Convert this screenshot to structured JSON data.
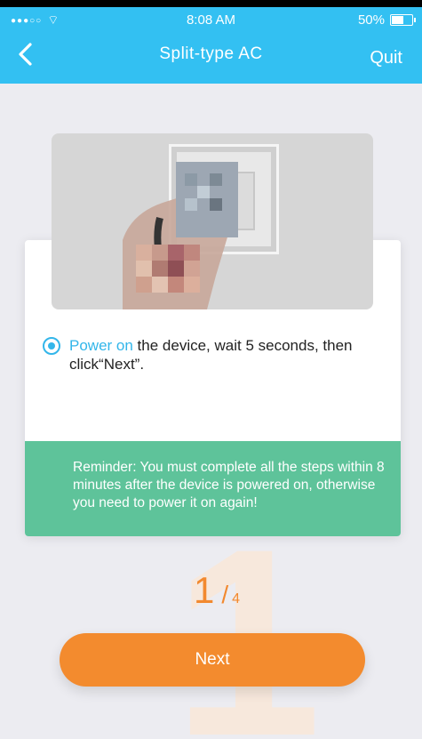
{
  "status_bar": {
    "time": "8:08 AM",
    "battery": "50%"
  },
  "nav": {
    "title": "Split-type AC",
    "quit_label": "Quit"
  },
  "instruction": {
    "highlight": "Power on",
    "text": " the device, wait 5 seconds, then click“Next”."
  },
  "reminder": {
    "text": "Reminder: You must complete all the steps within 8 minutes after the device is powered on, otherwise you need to power it on again!"
  },
  "progress": {
    "current": "1",
    "separator": "/",
    "total": "4",
    "background_number": "1"
  },
  "actions": {
    "next_label": "Next"
  },
  "colors": {
    "header": "#33c0f2",
    "accent_blue": "#33b6ea",
    "reminder_green": "#5ec39a",
    "button_orange": "#f38b2e"
  }
}
